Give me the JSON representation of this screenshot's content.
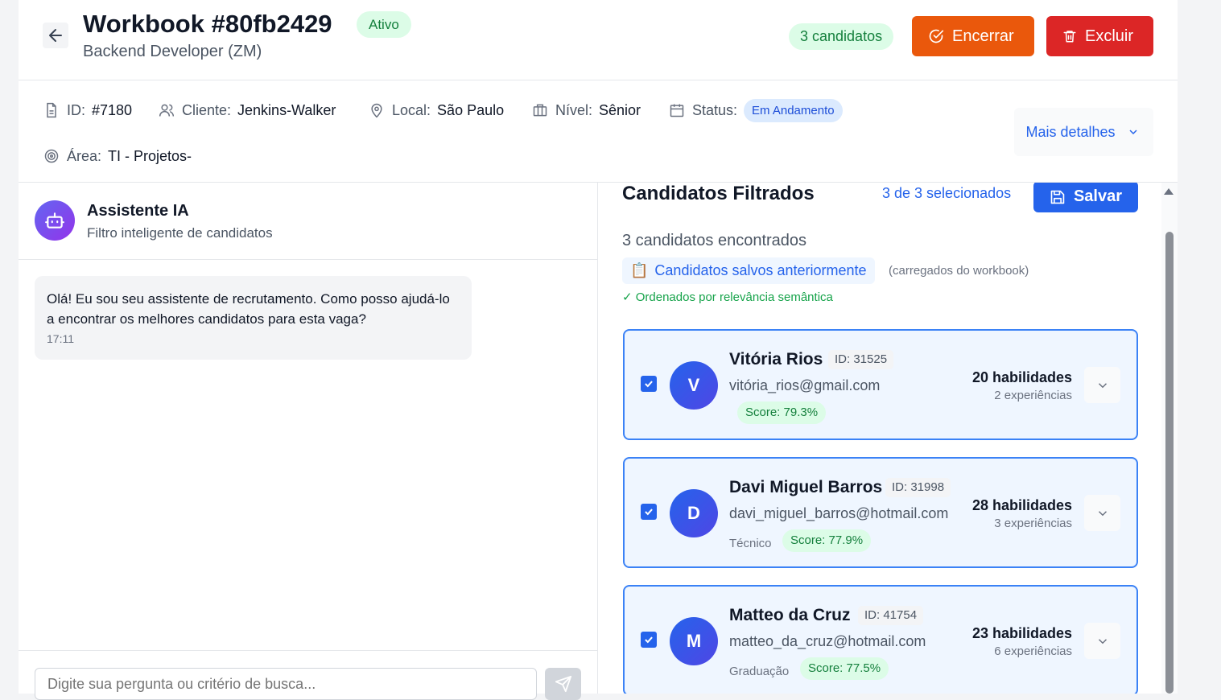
{
  "header": {
    "title": "Workbook #80fb2429",
    "status_badge": "Ativo",
    "subtitle": "Backend Developer (ZM)",
    "candidates_badge": "3 candidatos",
    "encerrar_label": "Encerrar",
    "excluir_label": "Excluir"
  },
  "meta": {
    "id_label": "ID:",
    "id_value": "#7180",
    "cliente_label": "Cliente:",
    "cliente_value": "Jenkins-Walker",
    "local_label": "Local:",
    "local_value": "São Paulo",
    "nivel_label": "Nível:",
    "nivel_value": "Sênior",
    "status_label": "Status:",
    "status_value": "Em Andamento",
    "area_label": "Área:",
    "area_value": "TI - Projetos-",
    "mais_detalhes": "Mais detalhes"
  },
  "assistant": {
    "title": "Assistente IA",
    "subtitle": "Filtro inteligente de candidatos",
    "message": "Olá! Eu sou seu assistente de recrutamento. Como posso ajudá-lo a encontrar os melhores candidatos para esta vaga?",
    "message_time": "17:11",
    "input_placeholder": "Digite sua pergunta ou critério de busca..."
  },
  "candidates_panel": {
    "title": "Candidatos Filtrados",
    "selected_count": "3 de 3 selecionados",
    "save_label": "Salvar",
    "found": "3 candidatos encontrados",
    "saved_pill_icon": "📋",
    "saved_pill": "Candidatos salvos anteriormente",
    "saved_note": "(carregados do workbook)",
    "ordered_note": "✓ Ordenados por relevância semântica",
    "candidates": [
      {
        "initial": "V",
        "name": "Vitória Rios",
        "id": "ID: 31525",
        "email": "vitória_rios@gmail.com",
        "tag": "",
        "score": "Score: 79.3%",
        "skills": "20 habilidades",
        "experiences": "2 experiências",
        "checked": true
      },
      {
        "initial": "D",
        "name": "Davi Miguel Barros",
        "id": "ID: 31998",
        "email": "davi_miguel_barros@hotmail.com",
        "tag": "Técnico",
        "score": "Score: 77.9%",
        "skills": "28 habilidades",
        "experiences": "3 experiências",
        "checked": true
      },
      {
        "initial": "M",
        "name": "Matteo da Cruz",
        "id": "ID: 41754",
        "email": "matteo_da_cruz@hotmail.com",
        "tag": "Graduação",
        "score": "Score: 77.5%",
        "skills": "23 habilidades",
        "experiences": "6 experiências",
        "checked": true
      }
    ]
  },
  "colors": {
    "primary": "#2563eb",
    "encerrar": "#ea580c",
    "excluir": "#dc2626",
    "success": "#15803d"
  },
  "icons": {
    "back": "arrow-left-icon",
    "encerrar": "check-circle-icon",
    "excluir": "trash-icon",
    "save": "save-icon",
    "send": "send-icon",
    "bot": "bot-icon",
    "expand": "chevron-down-icon"
  }
}
